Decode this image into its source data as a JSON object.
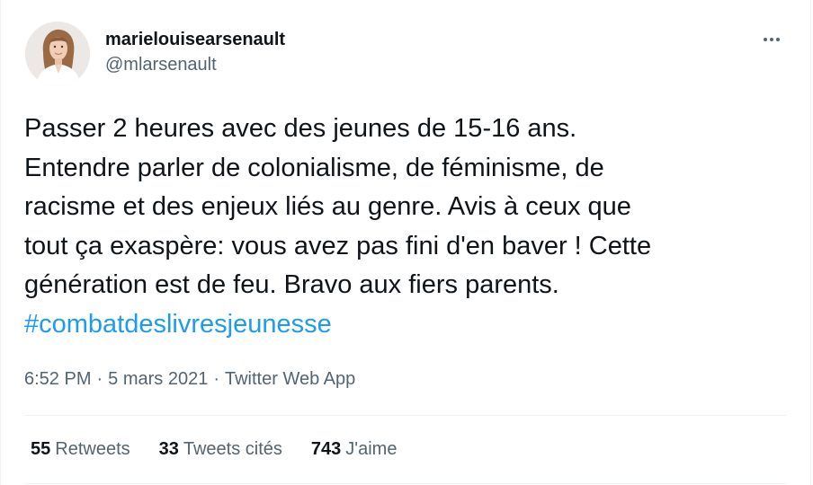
{
  "user": {
    "display_name": "marielouisearsenault",
    "handle": "@mlarsenault",
    "avatar_icon": "profile-photo"
  },
  "tweet": {
    "lines": [
      "Passer 2 heures avec des jeunes de 15-16 ans.",
      "Entendre parler de colonialisme, de féminisme, de",
      "racisme et des enjeux liés au genre. Avis à ceux que",
      "tout ça exaspère: vous avez pas fini d'en baver ! Cette",
      "génération est de feu. Bravo aux fiers parents."
    ],
    "hashtag": "#combatdeslivresjeunesse"
  },
  "meta": {
    "time": "6:52 PM",
    "separator": "·",
    "date": "5 mars 2021",
    "source": "Twitter Web App"
  },
  "stats": {
    "retweets_count": "55",
    "retweets_label": "Retweets",
    "quotes_count": "33",
    "quotes_label": "Tweets cités",
    "likes_count": "743",
    "likes_label": "J'aime"
  },
  "colors": {
    "link": "#1d9bf0",
    "secondary_text": "#536471",
    "primary_text": "#0f1419",
    "divider": "#eff3f4"
  },
  "icons": {
    "more": "more-horizontal-icon"
  }
}
